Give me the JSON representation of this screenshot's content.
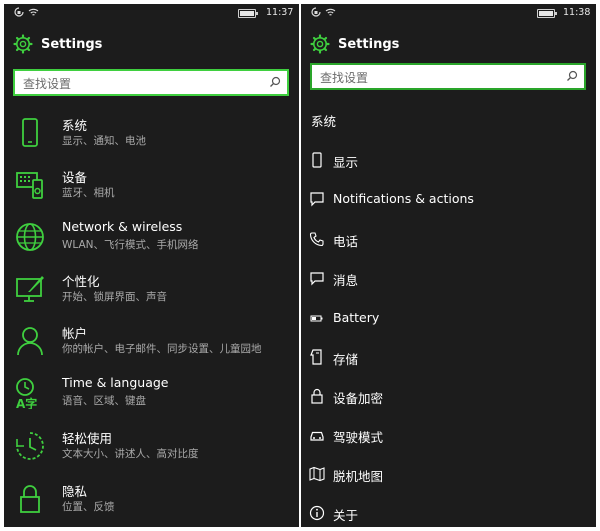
{
  "colors": {
    "accent": "#3fcf3f",
    "background": "#1c1c1c",
    "subtext": "#a9a9a9"
  },
  "left": {
    "status": {
      "time": "11:37"
    },
    "header": {
      "title": "Settings",
      "icon": "gear-icon"
    },
    "search": {
      "placeholder": "查找设置"
    },
    "categories": [
      {
        "label": "系统",
        "subtitle": "显示、通知、电池",
        "icon": "phone-icon"
      },
      {
        "label": "设备",
        "subtitle": "蓝牙、相机",
        "icon": "devices-icon"
      },
      {
        "label": "Network & wireless",
        "subtitle": "WLAN、飞行模式、手机网络",
        "icon": "globe-icon"
      },
      {
        "label": "个性化",
        "subtitle": "开始、锁屏界面、声音",
        "icon": "personalization-icon"
      },
      {
        "label": "帐户",
        "subtitle": "你的帐户、电子邮件、同步设置、儿童园地",
        "icon": "person-icon"
      },
      {
        "label": "Time & language",
        "subtitle": "语音、区域、键盘",
        "icon": "time-language-icon"
      },
      {
        "label": "轻松使用",
        "subtitle": "文本大小、讲述人、高对比度",
        "icon": "ease-of-access-icon"
      },
      {
        "label": "隐私",
        "subtitle": "位置、反馈",
        "icon": "lock-icon"
      }
    ]
  },
  "right": {
    "status": {
      "time": "11:38"
    },
    "header": {
      "title": "Settings",
      "icon": "gear-icon"
    },
    "search": {
      "placeholder": "查找设置"
    },
    "section_title": "系统",
    "items": [
      {
        "label": "显示",
        "icon": "display-icon"
      },
      {
        "label": "Notifications & actions",
        "icon": "notification-icon"
      },
      {
        "label": "电话",
        "icon": "phone-call-icon"
      },
      {
        "label": "消息",
        "icon": "message-icon"
      },
      {
        "label": "Battery",
        "icon": "battery-icon"
      },
      {
        "label": "存储",
        "icon": "storage-icon"
      },
      {
        "label": "设备加密",
        "icon": "lock-icon"
      },
      {
        "label": "驾驶模式",
        "icon": "car-icon"
      },
      {
        "label": "脱机地图",
        "icon": "map-icon"
      },
      {
        "label": "关于",
        "icon": "info-icon"
      }
    ]
  }
}
